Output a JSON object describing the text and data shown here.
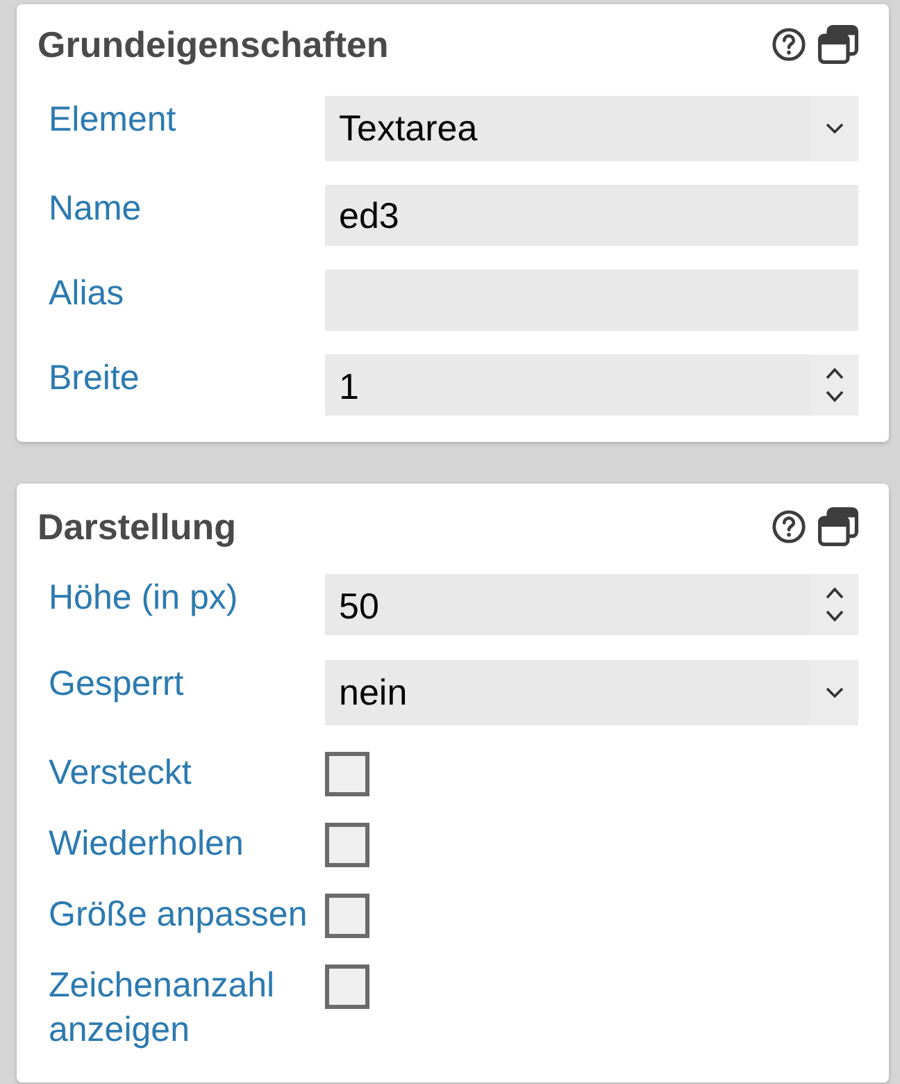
{
  "panels": [
    {
      "title": "Grundeigenschaften",
      "fields": [
        {
          "label": "Element",
          "kind": "select",
          "value": "Textarea"
        },
        {
          "label": "Name",
          "kind": "text",
          "value": "ed3"
        },
        {
          "label": "Alias",
          "kind": "text"
        },
        {
          "label": "Breite",
          "kind": "number",
          "value": "1"
        }
      ]
    },
    {
      "title": "Darstellung",
      "fields": [
        {
          "label": "Höhe (in px)",
          "kind": "number",
          "value": "50"
        },
        {
          "label": "Gesperrt",
          "kind": "select",
          "value": "nein"
        },
        {
          "label": "Versteckt",
          "kind": "checkbox",
          "checked": false
        },
        {
          "label": "Wiederholen",
          "kind": "checkbox",
          "checked": false
        },
        {
          "label": "Größe anpassen",
          "kind": "checkbox",
          "checked": false
        },
        {
          "label": "Zeichenanzahl anzeigen",
          "kind": "checkbox",
          "checked": false
        }
      ]
    }
  ]
}
